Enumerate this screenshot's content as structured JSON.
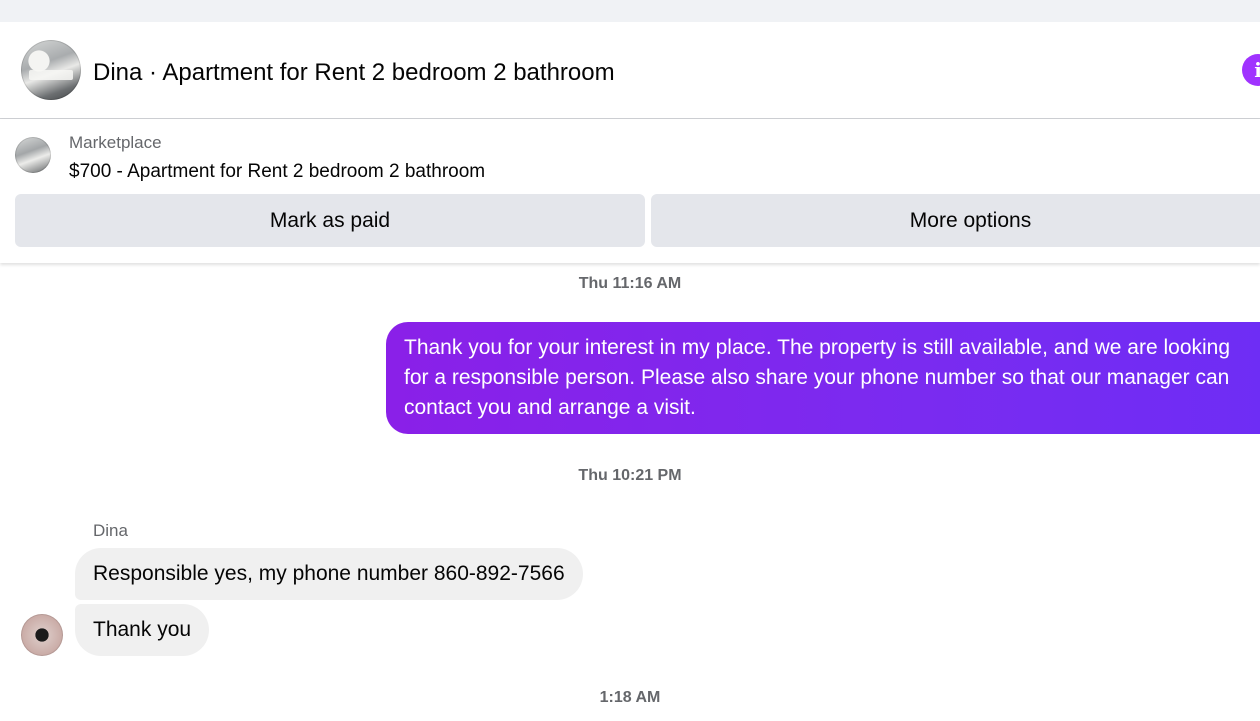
{
  "conversation": {
    "title": "Dina · Apartment for Rent 2 bedroom 2 bathroom",
    "info_icon": "info-icon"
  },
  "marketplace": {
    "label": "Marketplace",
    "listing": "$700 - Apartment for Rent 2 bedroom 2 bathroom",
    "mark_paid_label": "Mark as paid",
    "more_options_label": "More options"
  },
  "messages": {
    "ts1": "Thu 11:16 AM",
    "outgoing1": "Thank you for your interest in my place. The property is still available, and we are looking for a responsible person. Please also share your phone number so that our manager can contact you and arrange a visit.",
    "ts2": "Thu 10:21 PM",
    "sender": "Dina",
    "incoming1": "Responsible yes, my phone number 860-892-7566",
    "incoming2": "Thank you",
    "ts3": "1:18 AM"
  },
  "colors": {
    "outgoing_bubble": "#7a2bf0",
    "incoming_bubble": "#f0f0f0",
    "accent": "#a033ff",
    "button_bg": "#e4e6eb"
  }
}
